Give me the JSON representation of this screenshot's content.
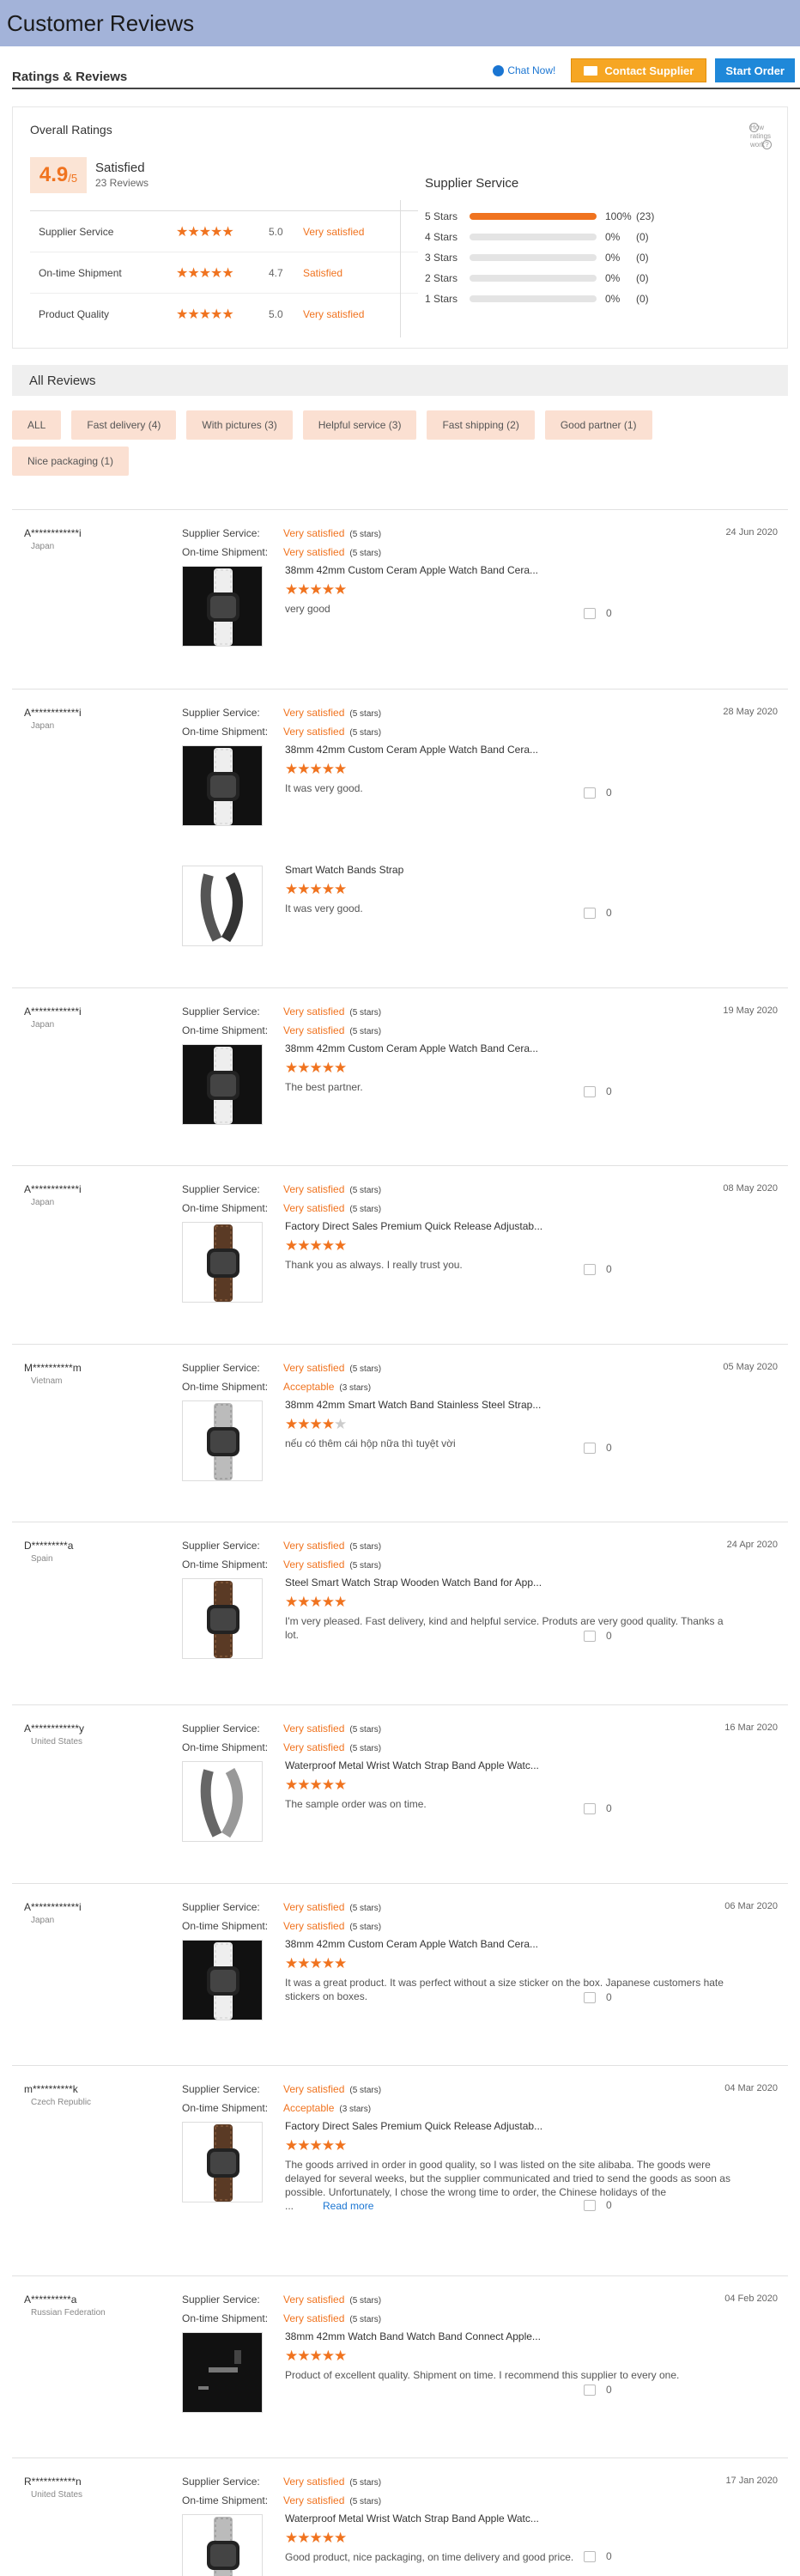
{
  "page": {
    "title": "Customer Reviews"
  },
  "header": {
    "title": "Ratings & Reviews",
    "chat": "Chat Now!",
    "contact": "Contact Supplier",
    "order": "Start Order"
  },
  "overall": {
    "title": "Overall Ratings",
    "how": "How ratings work",
    "score": "4.9",
    "out_of": "/5",
    "label": "Satisfied",
    "count": "23 Reviews",
    "metrics": [
      {
        "label": "Supplier Service",
        "stars": 5.0,
        "value": "5.0",
        "text": "Very satisfied"
      },
      {
        "label": "On-time Shipment",
        "stars": 4.7,
        "value": "4.7",
        "text": "Satisfied"
      },
      {
        "label": "Product Quality",
        "stars": 5.0,
        "value": "5.0",
        "text": "Very satisfied"
      }
    ],
    "dist_title": "Supplier Service",
    "dist": [
      {
        "label": "5 Stars",
        "fill": 1.0,
        "pct": "100%",
        "count": "(23)"
      },
      {
        "label": "4 Stars",
        "fill": 0,
        "pct": "0%",
        "count": "(0)"
      },
      {
        "label": "3 Stars",
        "fill": 0,
        "pct": "0%",
        "count": "(0)"
      },
      {
        "label": "2 Stars",
        "fill": 0,
        "pct": "0%",
        "count": "(0)"
      },
      {
        "label": "1 Stars",
        "fill": 0,
        "pct": "0%",
        "count": "(0)"
      }
    ]
  },
  "all_reviews": "All Reviews",
  "tags": [
    "ALL",
    "Fast delivery (4)",
    "With pictures (3)",
    "Helpful service (3)",
    "Fast shipping (2)",
    "Good partner (1)",
    "Nice packaging (1)"
  ],
  "labels": {
    "ss": "Supplier Service:",
    "ots": "On-time Shipment:"
  },
  "reviews": [
    {
      "user": "A************i",
      "country": "Japan",
      "date": "24 Jun 2020",
      "ss": "Very satisfied",
      "ss_s": "(5 stars)",
      "ots": "Very satisfied",
      "ots_s": "(5 stars)",
      "products": [
        {
          "title": "38mm 42mm Custom Ceram Apple Watch Band Cera...",
          "stars": 5,
          "text": "very good",
          "likes": "0",
          "img": "white"
        }
      ]
    },
    {
      "user": "A************i",
      "country": "Japan",
      "date": "28 May 2020",
      "ss": "Very satisfied",
      "ss_s": "(5 stars)",
      "ots": "Very satisfied",
      "ots_s": "(5 stars)",
      "products": [
        {
          "title": "38mm 42mm Custom Ceram Apple Watch Band Cera...",
          "stars": 5,
          "text": "It was very good.",
          "likes": "0",
          "img": "white"
        },
        {
          "title": "Smart Watch Bands Strap",
          "stars": 5,
          "text": "It was very good.",
          "likes": "0",
          "img": "darklink"
        }
      ]
    },
    {
      "user": "A************i",
      "country": "Japan",
      "date": "19 May 2020",
      "ss": "Very satisfied",
      "ss_s": "(5 stars)",
      "ots": "Very satisfied",
      "ots_s": "(5 stars)",
      "products": [
        {
          "title": "38mm 42mm Custom Ceram Apple Watch Band Cera...",
          "stars": 5,
          "text": "The best partner.",
          "likes": "0",
          "img": "white"
        }
      ]
    },
    {
      "user": "A************i",
      "country": "Japan",
      "date": "08 May 2020",
      "ss": "Very satisfied",
      "ss_s": "(5 stars)",
      "ots": "Very satisfied",
      "ots_s": "(5 stars)",
      "products": [
        {
          "title": "Factory Direct Sales Premium Quick Release Adjustab...",
          "stars": 5,
          "text": "Thank you as always.  I really trust you.",
          "likes": "0",
          "img": "wood"
        }
      ]
    },
    {
      "user": "M**********m",
      "country": "Vietnam",
      "date": "05 May 2020",
      "ss": "Very satisfied",
      "ss_s": "(5 stars)",
      "ots": "Acceptable",
      "ots_s": "(3 stars)",
      "products": [
        {
          "title": "38mm 42mm Smart Watch Band Stainless Steel Strap...",
          "stars": 4,
          "text": "nếu có thêm cái hộp nữa thì tuyệt vời",
          "likes": "0",
          "img": "steel"
        }
      ]
    },
    {
      "user": "D*********a",
      "country": "Spain",
      "date": "24 Apr 2020",
      "ss": "Very satisfied",
      "ss_s": "(5 stars)",
      "ots": "Very satisfied",
      "ots_s": "(5 stars)",
      "products": [
        {
          "title": "Steel Smart Watch Strap Wooden Watch Band for App...",
          "stars": 5,
          "text": "I'm very pleased. Fast delivery, kind and helpful service. Produts are very good quality. Thanks a lot.",
          "likes": "0",
          "img": "wood"
        }
      ]
    },
    {
      "user": "A************y",
      "country": "United States",
      "date": "16 Mar 2020",
      "ss": "Very satisfied",
      "ss_s": "(5 stars)",
      "ots": "Very satisfied",
      "ots_s": "(5 stars)",
      "products": [
        {
          "title": "Waterproof Metal Wrist Watch Strap Band Apple Watc...",
          "stars": 5,
          "text": "The sample order was on time.",
          "likes": "0",
          "img": "link"
        }
      ]
    },
    {
      "user": "A************i",
      "country": "Japan",
      "date": "06 Mar 2020",
      "ss": "Very satisfied",
      "ss_s": "(5 stars)",
      "ots": "Very satisfied",
      "ots_s": "(5 stars)",
      "products": [
        {
          "title": "38mm 42mm Custom Ceram Apple Watch Band Cera...",
          "stars": 5,
          "text": "It was a great product.  It was perfect without a size sticker on the box.  Japanese customers hate stickers on boxes.",
          "likes": "0",
          "img": "white"
        }
      ]
    },
    {
      "user": "m**********k",
      "country": "Czech Republic",
      "date": "04 Mar 2020",
      "ss": "Very satisfied",
      "ss_s": "(5 stars)",
      "ots": "Acceptable",
      "ots_s": "(3 stars)",
      "products": [
        {
          "title": "Factory Direct Sales Premium Quick Release Adjustab...",
          "stars": 5,
          "text": "The goods arrived in order in good quality, so I was listed on the site alibaba.  The goods were delayed for several weeks, but the supplier communicated and tried to send the goods as soon as possible.  Unfortunately, I chose the wrong time to order, the Chinese holidays of the ...",
          "more": "Read more",
          "likes": "0",
          "img": "wood"
        }
      ]
    },
    {
      "user": "A**********a",
      "country": "Russian Federation",
      "date": "04 Feb 2020",
      "ss": "Very satisfied",
      "ss_s": "(5 stars)",
      "ots": "Very satisfied",
      "ots_s": "(5 stars)",
      "products": [
        {
          "title": "38mm 42mm Watch Band Watch Band Connect Apple...",
          "stars": 5,
          "text": "Product of excellent quality. Shipment on time. I recommend this supplier to every one.",
          "likes": "0",
          "img": "connector"
        }
      ]
    },
    {
      "user": "R***********n",
      "country": "United States",
      "date": "17 Jan 2020",
      "ss": "Very satisfied",
      "ss_s": "(5 stars)",
      "ots": "Very satisfied",
      "ots_s": "(5 stars)",
      "products": [
        {
          "title": "Waterproof Metal Wrist Watch Strap Band Apple Watc...",
          "stars": 5,
          "text": "Good product, nice packaging, on time delivery and good price.",
          "likes": "0",
          "img": "steel",
          "extra": true
        }
      ]
    }
  ],
  "colors": {
    "accent": "#f0731f",
    "banner": "#a3b3d9",
    "tag": "#fbe0d2",
    "order": "#1f88d9",
    "contact": "#f6a623"
  }
}
